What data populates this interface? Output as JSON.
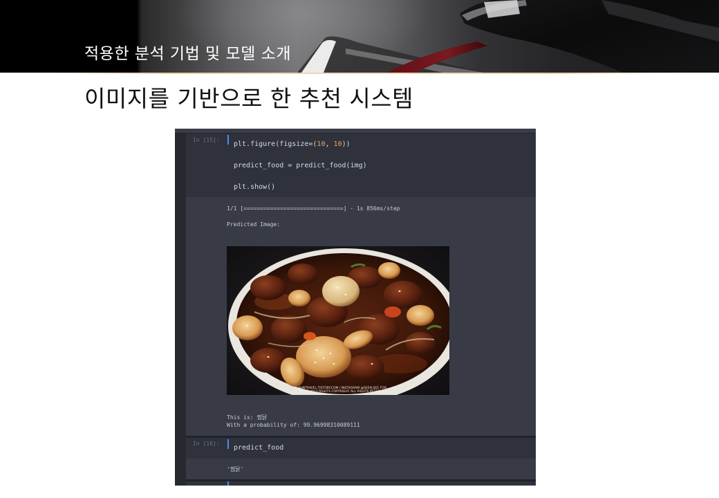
{
  "header": {
    "section_title": "적용한 분석 기법 및 모델 소개"
  },
  "slide": {
    "title": "이미지를 기반으로 한 추천 시스템"
  },
  "notebook": {
    "cell15": {
      "prompt": "In [15]:",
      "line1_pre": "plt.figure(figsize=(",
      "line1_n1": "10",
      "line1_mid": ", ",
      "line1_n2": "10",
      "line1_post": "))",
      "line2": "predict_food = predict_food(img)",
      "line3": "plt.show()"
    },
    "out15": {
      "progress": "1/1 [==============================] - 1s 856ms/step",
      "predicted_label": "Predicted Image:",
      "result_line": "This is: 찜닭",
      "probability_line": "With a probability of: 99.96998310089111"
    },
    "image": {
      "watermark_line1": "AHNTRAVEL.TISTORY.COM / INSTAGRAM @SEEN.SEE.TOO",
      "watermark_line2": "SINCE 2013 RIGHTS COPYRIGHT ALL RIGHTS RESERVED"
    },
    "cell16": {
      "prompt": "In [16]:",
      "line1": "predict_food"
    },
    "out16": {
      "value": "'찜닭'"
    }
  },
  "colors": {
    "notebook_bg": "#2d3039",
    "code_text": "#d6dbe4",
    "number": "#f0a45d",
    "prompt_bar": "#4b8ef0"
  }
}
